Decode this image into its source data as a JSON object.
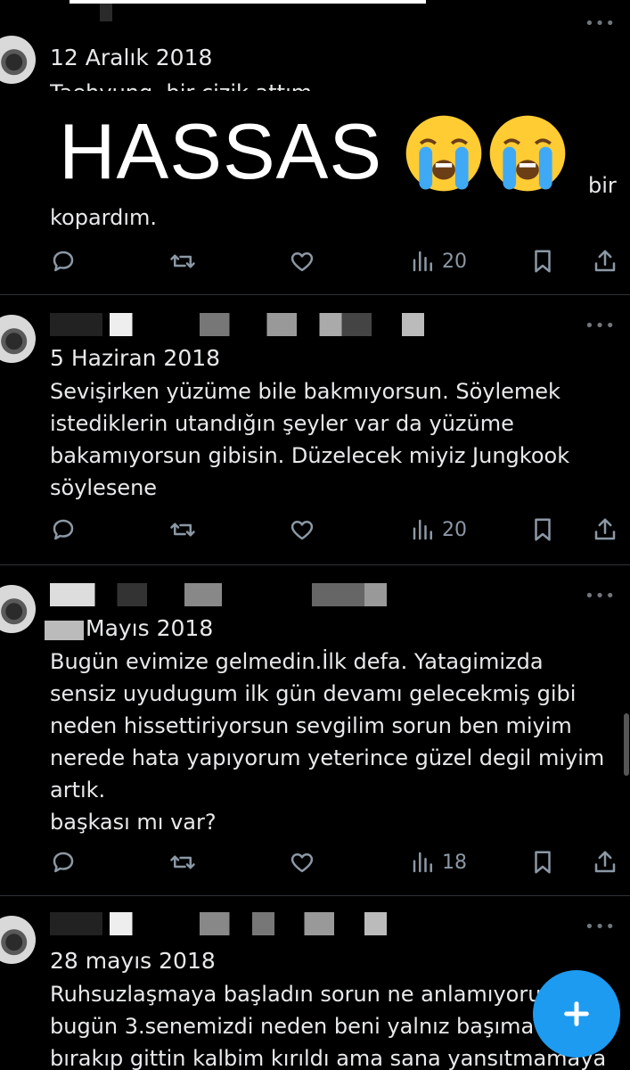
{
  "overlay": {
    "caption": "HASSAS",
    "emoji": [
      "loudly-crying-face",
      "loudly-crying-face"
    ]
  },
  "tweets": [
    {
      "date": "12 Aralık 2018",
      "peek": "Taehyung, bir çizik attım",
      "tail_right": "bir",
      "last_line": "kopardım.",
      "views": "20"
    },
    {
      "date": "5 Haziran 2018",
      "text": "Sevişirken yüzüme bile bakmıyorsun. Söylemek\nistediklerin utandığın şeyler var da yüzüme\nbakamıyorsun gibisin. Düzelecek miyiz Jungkook\nsöylesene",
      "views": "20"
    },
    {
      "date": "Mayıs 2018",
      "text": "Bugün evimize gelmedin.İlk defa. Yatagimizda\nsensiz uyudugum ilk gün devamı gelecekmiş gibi\nneden hissettiriyorsun sevgilim sorun ben miyim\nnerede hata yapıyorum yeterince güzel degil miyim\nartık.\nbaşkası mı var?",
      "views": "18"
    },
    {
      "date": "28 mayıs 2018",
      "text": "Ruhsuzlaşmaya başladın sorun ne anlamıyorum\nbugün 3.senemizdi neden beni yalnız başıma\nbırakıp gittin kalbim kırıldı ama sana yansıtmamaya"
    }
  ],
  "icons": {
    "reply": "reply-icon",
    "retweet": "retweet-icon",
    "like": "heart-icon",
    "views": "views-icon",
    "bookmark": "bookmark-icon",
    "share": "share-icon",
    "more": "more-icon",
    "compose": "compose-plus-icon"
  },
  "colors": {
    "background": "#000000",
    "text": "#e7e9ea",
    "muted": "#8b98a5",
    "accent": "#1d9bf0"
  }
}
